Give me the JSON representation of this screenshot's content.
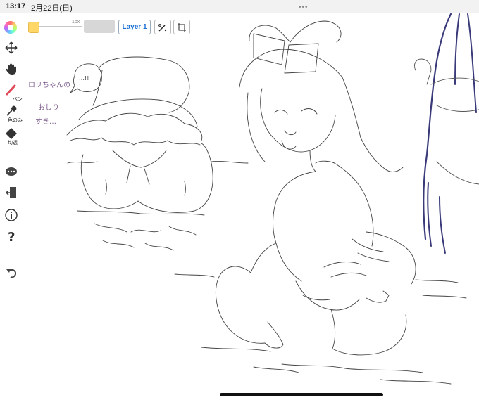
{
  "status": {
    "time": "13:17",
    "date": "2月22日(日)",
    "dots": "•••"
  },
  "toolbar": {
    "brush_size": "1px",
    "layer_label": "Layer 1",
    "swatch_color": "#ffd766"
  },
  "sidebar": {
    "pen_label": "ペン",
    "eyedropper_label": "色のみ",
    "eraser_label": "均透"
  },
  "canvas": {
    "handwritten_note": [
      "ロリちゃんの",
      "おしり",
      "すき…"
    ],
    "bubble_text": "…!!"
  }
}
